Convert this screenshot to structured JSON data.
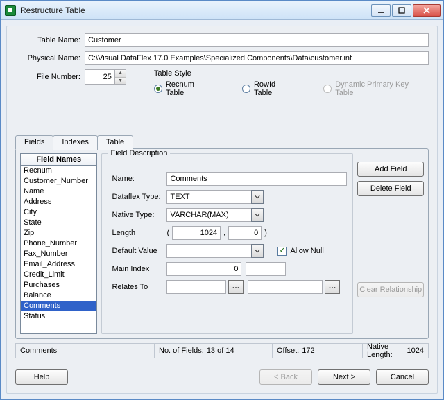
{
  "window": {
    "title": "Restructure Table"
  },
  "top": {
    "tableNameLabel": "Table Name:",
    "tableName": "Customer",
    "physicalNameLabel": "Physical Name:",
    "physicalName": "C:\\Visual DataFlex 17.0 Examples\\Specialized Components\\Data\\customer.int",
    "fileNumberLabel": "File Number:",
    "fileNumber": "25",
    "tableStyleLabel": "Table Style",
    "radioRecnum": "Recnum Table",
    "radioRowId": "RowId Table",
    "radioDynamic": "Dynamic Primary Key Table"
  },
  "tabs": {
    "fields": "Fields",
    "indexes": "Indexes",
    "table": "Table"
  },
  "fieldNames": {
    "header": "Field Names",
    "items": [
      "Recnum",
      "Customer_Number",
      "Name",
      "Address",
      "City",
      "State",
      "Zip",
      "Phone_Number",
      "Fax_Number",
      "Email_Address",
      "Credit_Limit",
      "Purchases",
      "Balance",
      "Comments",
      "Status"
    ],
    "selected": "Comments"
  },
  "fdesc": {
    "legend": "Field Description",
    "nameLabel": "Name:",
    "name": "Comments",
    "dfTypeLabel": "Dataflex Type:",
    "dfType": "TEXT",
    "nativeTypeLabel": "Native Type:",
    "nativeType": "VARCHAR(MAX)",
    "lengthLabel": "Length",
    "len1": "1024",
    "len2": "0",
    "defaultLabel": "Default Value",
    "default": "",
    "allowNullLabel": "Allow Null",
    "mainIndexLabel": "Main Index",
    "mainIndex": "0",
    "relatesToLabel": "Relates To",
    "relatesTo": ""
  },
  "side": {
    "add": "Add Field",
    "del": "Delete Field",
    "clear": "Clear Relationship"
  },
  "status": {
    "field": "Comments",
    "noFieldsLabel": "No. of Fields:",
    "noFields": "13 of 14",
    "offsetLabel": "Offset:",
    "offset": "172",
    "nativeLenLabel": "Native Length:",
    "nativeLen": "1024"
  },
  "wizard": {
    "help": "Help",
    "back": "< Back",
    "next": "Next >",
    "cancel": "Cancel"
  }
}
